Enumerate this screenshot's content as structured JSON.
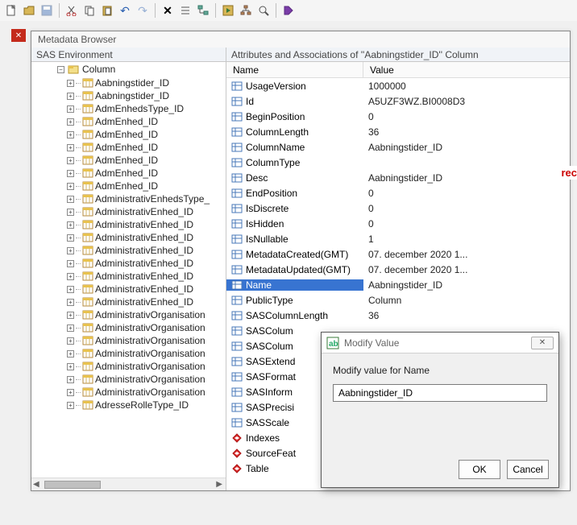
{
  "toolbar": {
    "icons": [
      "new",
      "open",
      "save",
      "cut",
      "copy",
      "paste",
      "undo",
      "redo",
      "delete",
      "list",
      "tree",
      "run",
      "org",
      "find",
      "help"
    ]
  },
  "browser": {
    "title": "Metadata Browser",
    "envLabel": "SAS Environment",
    "attrPanelLabel": "Attributes and Associations of ''Aabningstider_ID'' Column"
  },
  "tree": {
    "rootLabel": "Column",
    "items": [
      "Aabningstider_ID",
      "Aabningstider_ID",
      "AdmEnhedsType_ID",
      "AdmEnhed_ID",
      "AdmEnhed_ID",
      "AdmEnhed_ID",
      "AdmEnhed_ID",
      "AdmEnhed_ID",
      "AdmEnhed_ID",
      "AdministrativEnhedsType_",
      "AdministrativEnhed_ID",
      "AdministrativEnhed_ID",
      "AdministrativEnhed_ID",
      "AdministrativEnhed_ID",
      "AdministrativEnhed_ID",
      "AdministrativEnhed_ID",
      "AdministrativEnhed_ID",
      "AdministrativEnhed_ID",
      "AdministrativOrganisation",
      "AdministrativOrganisation",
      "AdministrativOrganisation",
      "AdministrativOrganisation",
      "AdministrativOrganisation",
      "AdministrativOrganisation",
      "AdministrativOrganisation",
      "AdresseRolleType_ID"
    ]
  },
  "attr": {
    "colNameHeader": "Name",
    "colValueHeader": "Value",
    "rows": [
      {
        "icon": "prop",
        "name": "UsageVersion",
        "value": "1000000"
      },
      {
        "icon": "prop",
        "name": "Id",
        "value": "A5UZF3WZ.BI0008D3"
      },
      {
        "icon": "prop",
        "name": "BeginPosition",
        "value": "0"
      },
      {
        "icon": "prop",
        "name": "ColumnLength",
        "value": "36"
      },
      {
        "icon": "prop",
        "name": "ColumnName",
        "value": "Aabningstider_ID"
      },
      {
        "icon": "prop",
        "name": "ColumnType",
        "value": ""
      },
      {
        "icon": "prop",
        "name": "Desc",
        "value": "Aabningstider_ID"
      },
      {
        "icon": "prop",
        "name": "EndPosition",
        "value": "0"
      },
      {
        "icon": "prop",
        "name": "IsDiscrete",
        "value": "0"
      },
      {
        "icon": "prop",
        "name": "IsHidden",
        "value": "0"
      },
      {
        "icon": "prop",
        "name": "IsNullable",
        "value": "1"
      },
      {
        "icon": "prop",
        "name": "MetadataCreated(GMT)",
        "value": "07. december 2020 1..."
      },
      {
        "icon": "prop",
        "name": "MetadataUpdated(GMT)",
        "value": "07. december 2020 1..."
      },
      {
        "icon": "prop",
        "name": "Name",
        "value": "Aabningstider_ID",
        "selected": true
      },
      {
        "icon": "prop",
        "name": "PublicType",
        "value": "Column"
      },
      {
        "icon": "prop",
        "name": "SASColumnLength",
        "value": "36"
      },
      {
        "icon": "prop",
        "name": "SASColum",
        "value": ""
      },
      {
        "icon": "prop",
        "name": "SASColum",
        "value": ""
      },
      {
        "icon": "prop",
        "name": "SASExtend",
        "value": ""
      },
      {
        "icon": "prop",
        "name": "SASFormat",
        "value": ""
      },
      {
        "icon": "prop",
        "name": "SASInform",
        "value": ""
      },
      {
        "icon": "prop",
        "name": "SASPrecisi",
        "value": ""
      },
      {
        "icon": "prop",
        "name": "SASScale",
        "value": ""
      },
      {
        "icon": "assoc",
        "name": "Indexes",
        "value": ""
      },
      {
        "icon": "assoc",
        "name": "SourceFeat",
        "value": ""
      },
      {
        "icon": "assoc",
        "name": "Table",
        "value": ""
      }
    ]
  },
  "dialog": {
    "title": "Modify Value",
    "label": "Modify value for Name",
    "inputValue": "Aabningstider_ID",
    "ok": "OK",
    "cancel": "Cancel"
  },
  "hint": "rec"
}
